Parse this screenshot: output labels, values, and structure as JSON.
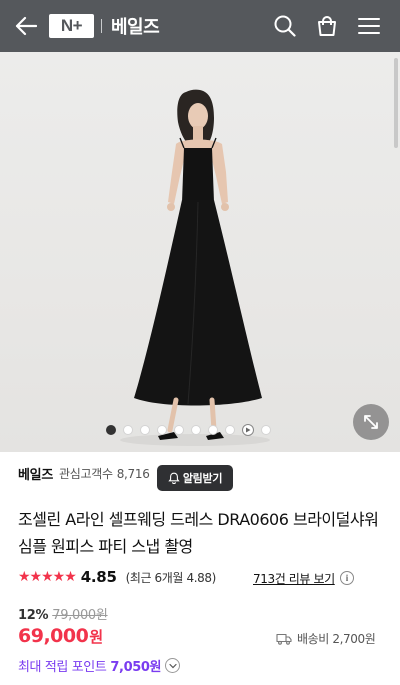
{
  "header": {
    "logo_text": "N+",
    "store_name": "베일즈",
    "icons": [
      "back-arrow-icon",
      "search-icon",
      "shopping-bag-icon",
      "hamburger-menu-icon"
    ],
    "bg_color": "#55585c"
  },
  "gallery": {
    "dot_count": 9,
    "active_index": 0,
    "has_video_dot": true
  },
  "seller": {
    "name": "베일즈",
    "followers_label": "관심고객수",
    "followers_count": "8,716",
    "alarm_button": "알림받기"
  },
  "product": {
    "title": "조셀린 A라인 셀프웨딩 드레스 DRA0606 브라이덜샤워 심플 원피스 파티 스냅 촬영",
    "rating": "4.85",
    "rating_stars": "★★★★★",
    "recent_rating": "(최근 6개월 4.88)",
    "review_link": "713건 리뷰 보기",
    "discount": "12%",
    "original_price": "79,000원",
    "price": "69,000",
    "price_unit": "원",
    "shipping": "배송비 2,700원",
    "points_label": "최대 적립 포인트",
    "points_value": "7,050원"
  },
  "colors": {
    "accent_red": "#f2334b",
    "points_purple": "#7a3cf0",
    "alarm_bg": "#2f3033"
  }
}
